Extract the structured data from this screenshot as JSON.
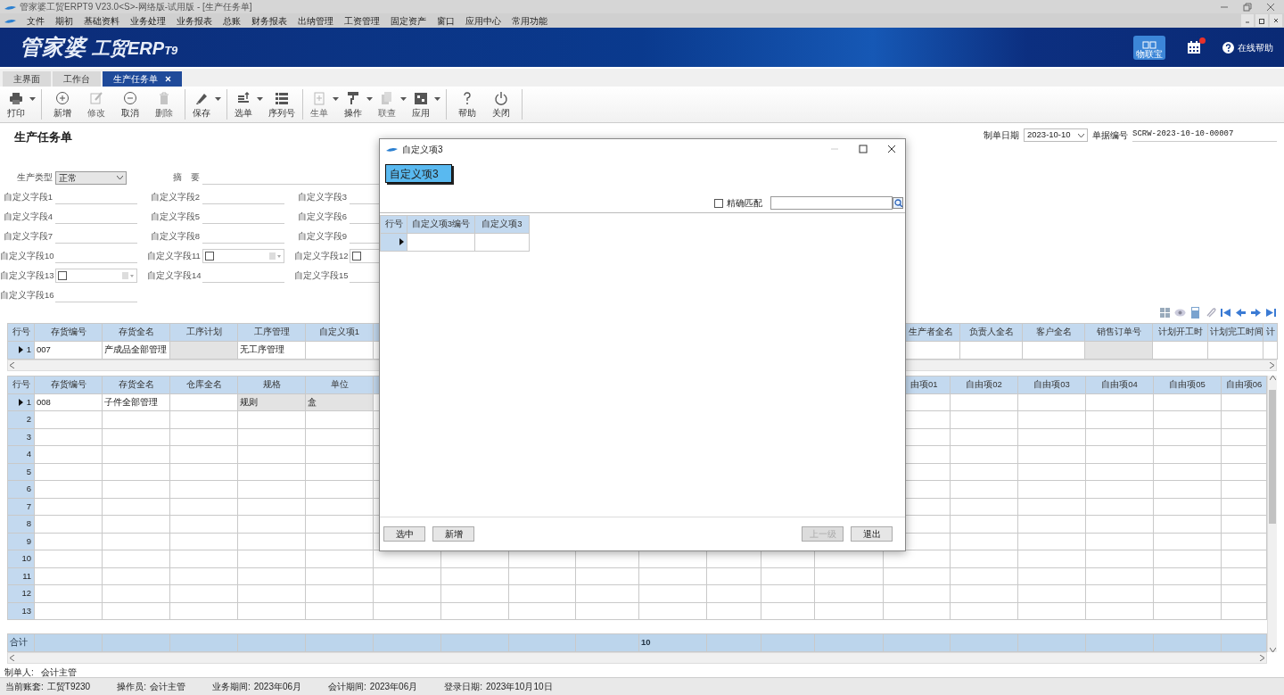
{
  "window": {
    "title": "管家婆工贸ERPT9 V23.0<S>-网络版-试用版 - [生产任务单]"
  },
  "menu": [
    "文件",
    "期初",
    "基础资料",
    "业务处理",
    "业务报表",
    "总账",
    "财务报表",
    "出纳管理",
    "工资管理",
    "固定资产",
    "窗口",
    "应用中心",
    "常用功能"
  ],
  "banner": {
    "logo": [
      "管家婆",
      "工贸ERP",
      "T9"
    ],
    "iot_label": "物联宝",
    "has_notification": true,
    "help": "在线帮助"
  },
  "tabs": [
    {
      "label": "主界面",
      "selected": false,
      "closable": false
    },
    {
      "label": "工作台",
      "selected": false,
      "closable": false
    },
    {
      "label": "生产任务单",
      "selected": true,
      "closable": true
    }
  ],
  "toolbar": [
    [
      {
        "label": "打印",
        "dropdown": true,
        "disabled": false
      }
    ],
    [
      {
        "label": "新增",
        "dropdown": false,
        "disabled": false
      },
      {
        "label": "修改",
        "dropdown": false,
        "disabled": true
      },
      {
        "label": "取消",
        "dropdown": false,
        "disabled": false
      },
      {
        "label": "删除",
        "dropdown": false,
        "disabled": true
      }
    ],
    [
      {
        "label": "保存",
        "dropdown": true,
        "disabled": false
      }
    ],
    [
      {
        "label": "选单",
        "dropdown": true,
        "disabled": false
      },
      {
        "label": "序列号",
        "dropdown": false,
        "disabled": false
      }
    ],
    [
      {
        "label": "生单",
        "dropdown": true,
        "disabled": true
      },
      {
        "label": "操作",
        "dropdown": true,
        "disabled": false
      },
      {
        "label": "联查",
        "dropdown": true,
        "disabled": true
      },
      {
        "label": "应用",
        "dropdown": true,
        "disabled": false
      }
    ],
    [
      {
        "label": "帮助",
        "dropdown": false,
        "disabled": false
      },
      {
        "label": "关闭",
        "dropdown": false,
        "disabled": false
      }
    ]
  ],
  "form": {
    "title": "生产任务单",
    "doc_date": {
      "label": "制单日期",
      "value": "2023-10-10"
    },
    "doc_number": {
      "label": "单据编号",
      "value": "SCRW-2023-10-10-00007"
    },
    "production_type": {
      "label": "生产类型",
      "value": "正常"
    },
    "summary": {
      "label": "摘　要"
    },
    "custom_fields": [
      {
        "label": "自定义字段1",
        "kind": "line"
      },
      {
        "label": "自定义字段2",
        "kind": "line"
      },
      {
        "label": "自定义字段3",
        "kind": "line"
      },
      {
        "label": "自定义字段4",
        "kind": "line"
      },
      {
        "label": "自定义字段5",
        "kind": "line"
      },
      {
        "label": "自定义字段6",
        "kind": "line"
      },
      {
        "label": "自定义字段7",
        "kind": "line"
      },
      {
        "label": "自定义字段8",
        "kind": "line"
      },
      {
        "label": "自定义字段9",
        "kind": "line"
      },
      {
        "label": "自定义字段10",
        "kind": "line"
      },
      {
        "label": "自定义字段11",
        "kind": "combo",
        "checked": false
      },
      {
        "label": "自定义字段12",
        "kind": "combo",
        "checked": false
      },
      {
        "label": "自定义字段13",
        "kind": "combo",
        "checked": false
      },
      {
        "label": "自定义字段14",
        "kind": "line"
      },
      {
        "label": "自定义字段15",
        "kind": "line"
      },
      {
        "label": "自定义字段16",
        "kind": "line"
      }
    ]
  },
  "product_grid": {
    "columns": [
      "行号",
      "存货编号",
      "存货全名",
      "工序计划",
      "工序管理",
      "自定义项1",
      "生产者全名",
      "负责人全名",
      "客户全名",
      "销售订单号",
      "计划开工时",
      "计划完工时间",
      "计"
    ],
    "rows": [
      {
        "number": "1",
        "code": "007",
        "name": "产成品全部管理",
        "process": "无工序管理",
        "selected": true
      }
    ]
  },
  "material_grid": {
    "columns": [
      "行号",
      "存货编号",
      "存货全名",
      "仓库全名",
      "规格",
      "单位",
      "由项01",
      "自由项02",
      "自由项03",
      "自由项04",
      "自由项05",
      "自由项06"
    ],
    "rows": [
      {
        "number": "1",
        "code": "008",
        "name": "子件全部管理",
        "spec": "规则",
        "unit": "盒",
        "selected": true
      },
      {
        "number": "2",
        "selected": false
      },
      {
        "number": "3",
        "selected": false
      },
      {
        "number": "4",
        "selected": false
      },
      {
        "number": "5",
        "selected": false
      },
      {
        "number": "6",
        "selected": false
      },
      {
        "number": "7",
        "selected": false
      },
      {
        "number": "8",
        "selected": false
      },
      {
        "number": "9",
        "selected": false
      },
      {
        "number": "10",
        "selected": false
      },
      {
        "number": "11",
        "selected": false
      },
      {
        "number": "12",
        "selected": false
      },
      {
        "number": "13",
        "selected": false
      }
    ],
    "total": {
      "label": "合计",
      "quantity": "10"
    }
  },
  "creator": {
    "label": "制单人:",
    "value": "会计主管"
  },
  "status_bar": [
    {
      "label": "当前账套:",
      "value": "工贸T9230"
    },
    {
      "label": "操作员:",
      "value": "会计主管"
    },
    {
      "label": "业务期间:",
      "value": "2023年06月"
    },
    {
      "label": "会计期间:",
      "value": "2023年06月"
    },
    {
      "label": "登录日期:",
      "value": "2023年10月10日"
    }
  ],
  "dialog": {
    "title": "自定义项3",
    "heading": "自定义项3",
    "exact_match": {
      "label": "精确匹配",
      "checked": false
    },
    "grid": {
      "columns": [
        "行号",
        "自定义项3编号",
        "自定义项3"
      ],
      "rows": [
        {
          "selected": true
        }
      ]
    },
    "buttons": [
      {
        "label": "选中",
        "disabled": false
      },
      {
        "label": "新增",
        "disabled": false
      },
      {
        "label": "上一级",
        "disabled": true
      },
      {
        "label": "退出",
        "disabled": false
      }
    ]
  }
}
